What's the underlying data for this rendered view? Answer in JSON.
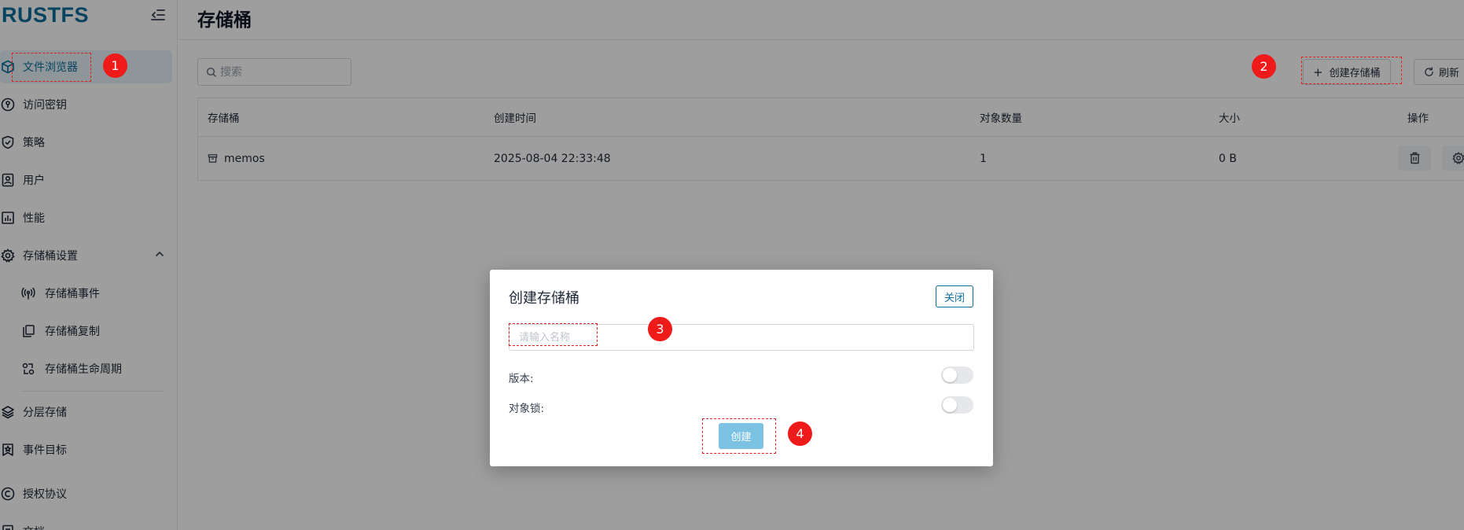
{
  "app": {
    "logo": "RUSTFS"
  },
  "sidebar": {
    "items": [
      {
        "label": "文件浏览器",
        "icon": "cube-icon",
        "active": true
      },
      {
        "label": "访问密钥",
        "icon": "key-circle-icon"
      },
      {
        "label": "策略",
        "icon": "shield-check-icon"
      },
      {
        "label": "用户",
        "icon": "user-card-icon"
      },
      {
        "label": "性能",
        "icon": "bar-chart-icon"
      },
      {
        "label": "存储桶设置",
        "icon": "gear-icon",
        "expanded": true
      },
      {
        "label": "存储桶事件",
        "icon": "broadcast-icon",
        "sub": true
      },
      {
        "label": "存储桶复制",
        "icon": "copy-icon",
        "sub": true
      },
      {
        "label": "存储桶生命周期",
        "icon": "lifecycle-icon",
        "sub": true
      },
      {
        "label": "分层存储",
        "icon": "layers-icon"
      },
      {
        "label": "事件目标",
        "icon": "bookmark-star-icon"
      },
      {
        "label": "授权协议",
        "icon": "copyright-icon"
      },
      {
        "label": "文档",
        "icon": "doc-icon"
      }
    ]
  },
  "header": {
    "title": "存储桶"
  },
  "toolbar": {
    "search_placeholder": "搜索",
    "create_label": "创建存储桶",
    "refresh_label": "刷新"
  },
  "table": {
    "columns": [
      "存储桶",
      "创建时间",
      "对象数量",
      "大小",
      "操作"
    ],
    "rows": [
      {
        "name": "memos",
        "created": "2025-08-04 22:33:48",
        "objects": "1",
        "size": "0 B"
      }
    ]
  },
  "modal": {
    "title": "创建存储桶",
    "close_label": "关闭",
    "name_placeholder": "请输入名称",
    "version_label": "版本:",
    "version_enabled": false,
    "object_lock_label": "对象锁:",
    "object_lock_enabled": false,
    "create_label": "创建"
  },
  "annotations": [
    "1",
    "2",
    "3",
    "4"
  ],
  "colors": {
    "accent": "#0b6e99",
    "annotation": "#ef1a1a",
    "create_button": "#7cc2e2"
  }
}
